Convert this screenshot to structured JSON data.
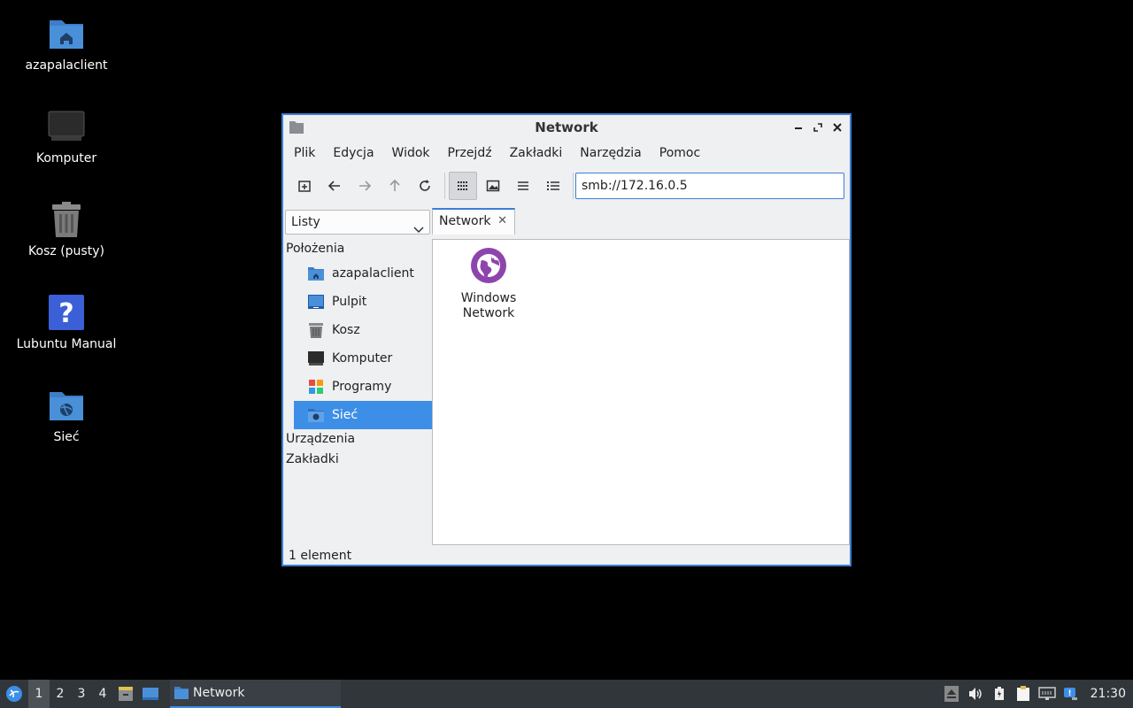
{
  "desktop": {
    "icons": [
      {
        "label": "azapalaclient",
        "icon": "home-folder-icon"
      },
      {
        "label": "Komputer",
        "icon": "computer-icon"
      },
      {
        "label": "Kosz (pusty)",
        "icon": "trash-icon"
      },
      {
        "label": "Lubuntu Manual",
        "icon": "help-icon"
      },
      {
        "label": "Sieć",
        "icon": "network-folder-icon"
      }
    ]
  },
  "window": {
    "title": "Network",
    "menu": [
      "Plik",
      "Edycja",
      "Widok",
      "Przejdź",
      "Zakładki",
      "Narzędzia",
      "Pomoc"
    ],
    "address": "smb://172.16.0.5",
    "side_pane_mode": "Listy",
    "tab_label": "Network",
    "sidebar": {
      "places_header": "Położenia",
      "items": [
        {
          "label": "azapalaclient",
          "icon": "home-folder-icon"
        },
        {
          "label": "Pulpit",
          "icon": "desktop-icon"
        },
        {
          "label": "Kosz",
          "icon": "trash-icon"
        },
        {
          "label": "Komputer",
          "icon": "computer-icon"
        },
        {
          "label": "Programy",
          "icon": "applications-icon"
        },
        {
          "label": "Sieć",
          "icon": "network-icon",
          "selected": true
        }
      ],
      "devices_header": "Urządzenia",
      "bookmarks_header": "Zakładki"
    },
    "files": [
      {
        "label": "Windows Network",
        "icon": "globe-icon"
      }
    ],
    "status": "1 element"
  },
  "taskbar": {
    "workspaces": [
      "1",
      "2",
      "3",
      "4"
    ],
    "active_workspace": "1",
    "task_label": "Network",
    "clock": "21:30"
  },
  "colors": {
    "accent": "#3d8ee6",
    "window_border": "#3c7fd6",
    "folder_blue": "#4a90d9",
    "globe_purple": "#8e44ad"
  }
}
